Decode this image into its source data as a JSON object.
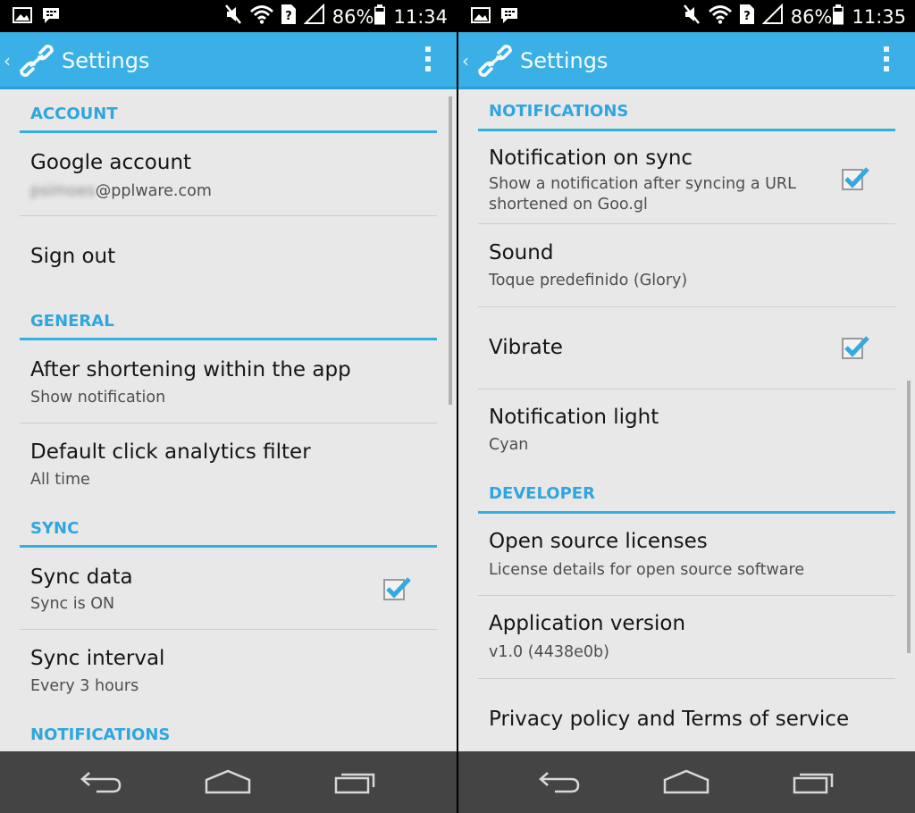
{
  "left": {
    "status": {
      "battery": "86%",
      "time": "11:34"
    },
    "actionbar": {
      "up": "‹",
      "title": "Settings"
    },
    "sections": {
      "account": "ACCOUNT",
      "general": "GENERAL",
      "sync": "SYNC",
      "notifications": "NOTIFICATIONS"
    },
    "prefs": {
      "google_account": {
        "title": "Google account",
        "summary_hidden": "psimoes",
        "summary": "@pplware.com"
      },
      "sign_out": {
        "title": "Sign out"
      },
      "after_shortening": {
        "title": "After shortening within the app",
        "summary": "Show notification"
      },
      "analytics_filter": {
        "title": "Default click analytics filter",
        "summary": "All time"
      },
      "sync_data": {
        "title": "Sync data",
        "summary": "Sync is ON",
        "checked": true
      },
      "sync_interval": {
        "title": "Sync interval",
        "summary": "Every 3 hours"
      }
    }
  },
  "right": {
    "status": {
      "battery": "86%",
      "time": "11:35"
    },
    "actionbar": {
      "up": "‹",
      "title": "Settings"
    },
    "sections": {
      "notifications": "NOTIFICATIONS",
      "developer": "DEVELOPER"
    },
    "prefs": {
      "notification_on_sync": {
        "title": "Notification on sync",
        "summary_line1": "Show a notification after syncing a URL",
        "summary_line2": "shortened on Goo.gl",
        "checked": true
      },
      "sound": {
        "title": "Sound",
        "summary": "Toque predefinido (Glory)"
      },
      "vibrate": {
        "title": "Vibrate",
        "checked": true
      },
      "notification_light": {
        "title": "Notification light",
        "summary": "Cyan"
      },
      "open_source": {
        "title": "Open source licenses",
        "summary": "License details for open source software"
      },
      "app_version": {
        "title": "Application version",
        "summary": "v1.0 (4438e0b)"
      },
      "privacy": {
        "title": "Privacy policy and Terms of service"
      }
    }
  },
  "colors": {
    "accent": "#35aee2",
    "actionbar": "#3bb0e6",
    "navbar": "#444444",
    "background": "#e8e8e8"
  },
  "icons": [
    "image-icon",
    "bbm-icon",
    "mute-icon",
    "wifi-icon",
    "sim-icon",
    "signal-icon",
    "battery-icon",
    "link-logo-icon",
    "overflow-menu-icon",
    "back-icon",
    "home-icon",
    "recents-icon",
    "checkbox-checked-icon"
  ]
}
